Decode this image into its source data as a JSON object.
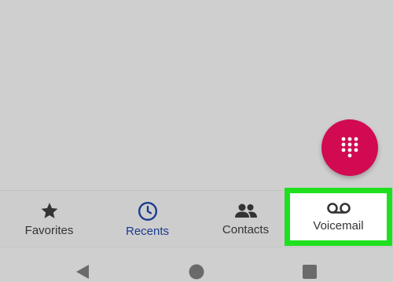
{
  "fab": {
    "icon": "dialpad-icon",
    "color": "#d10a52"
  },
  "bottom_nav": {
    "tabs": [
      {
        "label": "Favorites",
        "icon": "star-icon",
        "active": false
      },
      {
        "label": "Recents",
        "icon": "clock-icon",
        "active": true
      },
      {
        "label": "Contacts",
        "icon": "people-icon",
        "active": false
      },
      {
        "label": "Voicemail",
        "icon": "voicemail-icon",
        "active": false
      }
    ],
    "active_color": "#1a3a8f",
    "highlight_color": "#1ee01e"
  },
  "system_nav": {
    "buttons": [
      {
        "name": "back",
        "icon": "back-triangle-icon"
      },
      {
        "name": "home",
        "icon": "home-circle-icon"
      },
      {
        "name": "overview",
        "icon": "recents-square-icon"
      }
    ]
  }
}
